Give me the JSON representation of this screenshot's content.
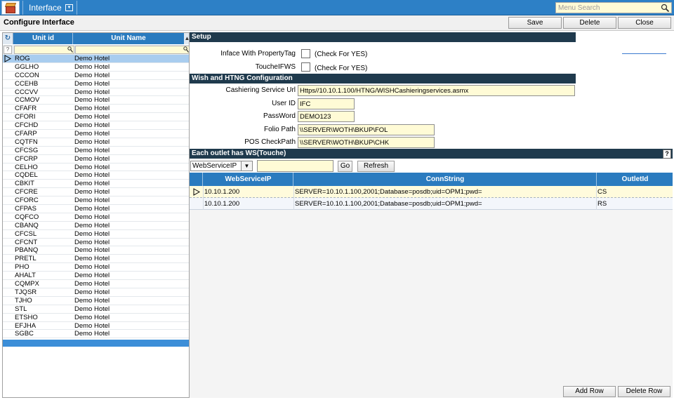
{
  "topbar": {
    "menu_label": "Interface",
    "search_placeholder": "Menu Search"
  },
  "title_row": {
    "title": "Configure Interface",
    "save_label": "Save",
    "delete_label": "Delete",
    "close_label": "Close"
  },
  "unit_grid": {
    "col_unit_id": "Unit id",
    "col_unit_name": "Unit Name",
    "rows": [
      {
        "id": "ROG",
        "name": "Demo Hotel"
      },
      {
        "id": "GGLHO",
        "name": "Demo Hotel"
      },
      {
        "id": "CCCON",
        "name": "Demo Hotel"
      },
      {
        "id": "CCEHB",
        "name": "Demo Hotel"
      },
      {
        "id": "CCCVV",
        "name": "Demo Hotel"
      },
      {
        "id": "CCMOV",
        "name": "Demo Hotel"
      },
      {
        "id": "CFAFR",
        "name": "Demo Hotel"
      },
      {
        "id": "CFORI",
        "name": "Demo Hotel"
      },
      {
        "id": "CFCHD",
        "name": "Demo Hotel"
      },
      {
        "id": "CFARP",
        "name": "Demo Hotel"
      },
      {
        "id": "CQTFN",
        "name": "Demo Hotel"
      },
      {
        "id": "CFCSG",
        "name": "Demo Hotel"
      },
      {
        "id": "CFCRP",
        "name": "Demo Hotel"
      },
      {
        "id": "CELHO",
        "name": "Demo Hotel"
      },
      {
        "id": "CQDEL",
        "name": "Demo Hotel"
      },
      {
        "id": "CBKIT",
        "name": "Demo Hotel"
      },
      {
        "id": "CFCRE",
        "name": "Demo Hotel"
      },
      {
        "id": "CFORC",
        "name": "Demo Hotel"
      },
      {
        "id": "CFPAS",
        "name": "Demo Hotel"
      },
      {
        "id": "CQFCO",
        "name": "Demo Hotel"
      },
      {
        "id": "CBANQ",
        "name": "Demo Hotel"
      },
      {
        "id": "CFCSL",
        "name": "Demo Hotel"
      },
      {
        "id": "CFCNT",
        "name": "Demo Hotel"
      },
      {
        "id": "PBANQ",
        "name": "Demo Hotel"
      },
      {
        "id": "PRETL",
        "name": "Demo Hotel"
      },
      {
        "id": "PHO",
        "name": "Demo Hotel"
      },
      {
        "id": "AHALT",
        "name": "Demo Hotel"
      },
      {
        "id": "CQMPX",
        "name": "Demo Hotel"
      },
      {
        "id": "TJQSR",
        "name": "Demo Hotel"
      },
      {
        "id": "TJHO",
        "name": "Demo Hotel"
      },
      {
        "id": "STL",
        "name": "Demo Hotel"
      },
      {
        "id": "ETSHO",
        "name": "Demo Hotel"
      },
      {
        "id": "EFJHA",
        "name": "Demo Hotel"
      },
      {
        "id": "SGBC",
        "name": "Demo Hotel"
      }
    ]
  },
  "setup": {
    "heading": "Setup",
    "inface_label": "Inface With PropertyTag",
    "inface_note": "(Check For YES)",
    "touche_label": "ToucheIFWS",
    "touche_note": "(Check For YES)"
  },
  "wish": {
    "heading": "Wish and HTNG Configuration",
    "cashiering_label": "Cashiering Service Url",
    "cashiering_value": "Https//10.10.1.100/HTNG/WISHCashieringservices.asmx",
    "userid_label": "User ID",
    "userid_value": "IFC",
    "password_label": "PassWord",
    "password_value": "DEMO123",
    "folio_label": "Folio Path",
    "folio_value": "\\\\SERVER\\WOTH\\BKUP\\FOL",
    "pos_label": "POS CheckPath",
    "pos_value": "\\\\SERVER\\WOTH\\BKUP\\CHK"
  },
  "outlet": {
    "heading": "Each outlet has WS(Touche)",
    "filter_select": "WebServiceIP",
    "go_label": "Go",
    "refresh_label": "Refresh",
    "col_ip": "WebServiceIP",
    "col_conn": "ConnString",
    "col_outlet": "OutletId",
    "rows": [
      {
        "ip": "10.10.1.200",
        "conn": "SERVER=10.10.1.100,2001;Database=posdb;uid=OPM1;pwd=",
        "outlet": "CS"
      },
      {
        "ip": "10.10.1.200",
        "conn": "SERVER=10.10.1.100,2001;Database=posdb;uid=OPM1;pwd=",
        "outlet": "RS"
      }
    ],
    "add_row_label": "Add Row",
    "delete_row_label": "Delete Row"
  }
}
